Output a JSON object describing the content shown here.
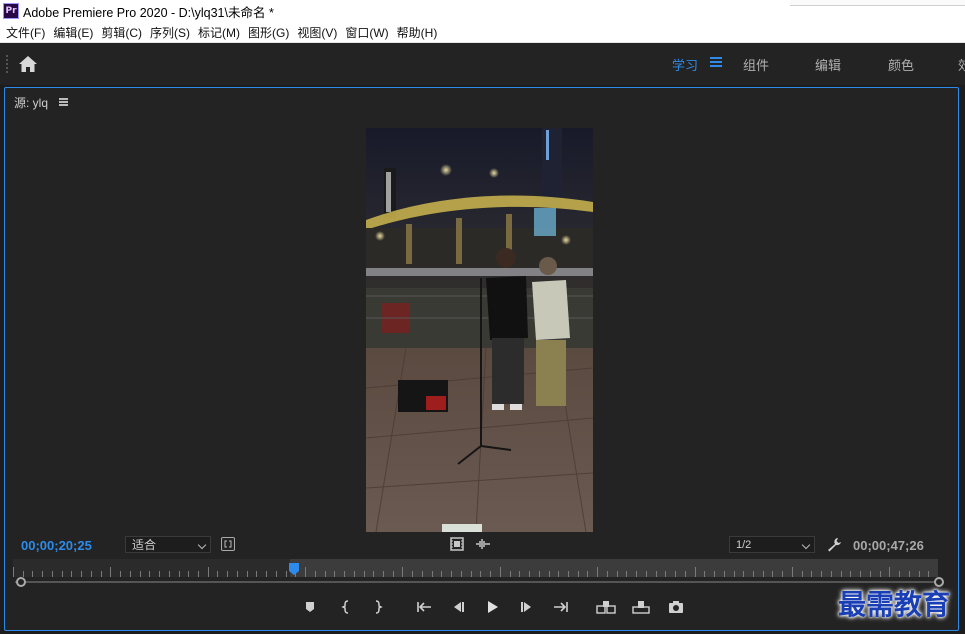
{
  "window": {
    "app_logo_text": "Pr",
    "title": "Adobe Premiere Pro 2020 - D:\\ylq31\\未命名 *"
  },
  "menu": [
    {
      "label": "文件(F)"
    },
    {
      "label": "编辑(E)"
    },
    {
      "label": "剪辑(C)"
    },
    {
      "label": "序列(S)"
    },
    {
      "label": "标记(M)"
    },
    {
      "label": "图形(G)"
    },
    {
      "label": "视图(V)"
    },
    {
      "label": "窗口(W)"
    },
    {
      "label": "帮助(H)"
    }
  ],
  "workspace": {
    "home_icon": "home-icon",
    "tabs": [
      {
        "label": "学习",
        "active": true
      },
      {
        "label": "组件",
        "active": false
      },
      {
        "label": "编辑",
        "active": false
      },
      {
        "label": "颜色",
        "active": false
      },
      {
        "label": "效",
        "active": false
      }
    ],
    "accent_color": "#2d8ceb"
  },
  "source_monitor": {
    "title": "源: ylq",
    "current_timecode": "00;00;20;25",
    "duration_timecode": "00;00;47;26",
    "fit_dropdown": "适合",
    "resolution_dropdown": "1/2",
    "playhead_fraction": 0.297,
    "icons": [
      "safe-margins-icon",
      "film-strip-icon",
      "audio-waveform-icon",
      "wrench-icon"
    ]
  },
  "transport": [
    {
      "name": "add-marker-icon"
    },
    {
      "name": "mark-in-icon"
    },
    {
      "name": "mark-out-icon"
    },
    {
      "name": "go-to-in-icon"
    },
    {
      "name": "step-back-icon"
    },
    {
      "name": "play-icon"
    },
    {
      "name": "step-forward-icon"
    },
    {
      "name": "go-to-out-icon"
    },
    {
      "name": "insert-icon"
    },
    {
      "name": "overwrite-icon"
    },
    {
      "name": "export-frame-icon"
    }
  ],
  "watermark": "最需教育"
}
